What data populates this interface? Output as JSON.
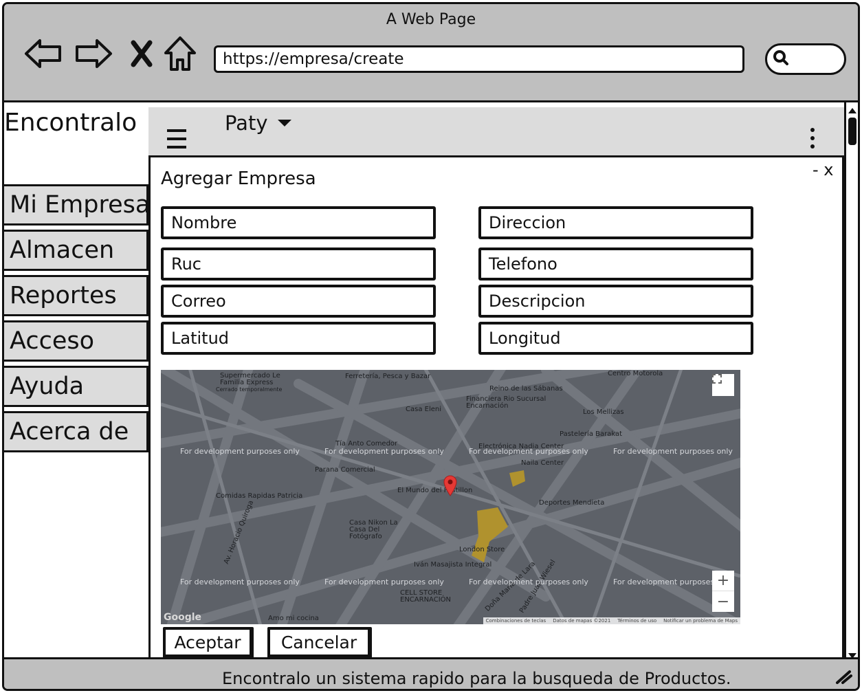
{
  "window": {
    "title": "A Web Page"
  },
  "browser": {
    "url": "https://empresa/create",
    "icons": [
      "back-icon",
      "forward-icon",
      "stop-icon",
      "home-icon",
      "search-icon"
    ]
  },
  "sidebar": {
    "brand": "Encontralo",
    "items": [
      {
        "label": "Mi Empresa"
      },
      {
        "label": "Almacen"
      },
      {
        "label": "Reportes"
      },
      {
        "label": "Acceso"
      },
      {
        "label": "Ayuda"
      },
      {
        "label": "Acerca de"
      }
    ]
  },
  "header": {
    "user": "Paty"
  },
  "dialog": {
    "title": "Agregar Empresa",
    "close": "- x",
    "fields": {
      "nombre": "Nombre",
      "direccion": "Direccion",
      "ruc": "Ruc",
      "telefono": "Telefono",
      "correo": "Correo",
      "descripcion": "Descripcion",
      "latitud": "Latitud",
      "longitud": "Longitud"
    },
    "map": {
      "watermark": "For development purposes only",
      "zoom_in": "+",
      "zoom_out": "−",
      "google": "Google",
      "footer": [
        "Combinaciones de teclas",
        "Datos de mapas ©2021",
        "Términos de uso",
        "Notificar un problema de Maps"
      ],
      "places": [
        "Supermercado Le Familia Express",
        "Cerrado temporalmente",
        "Ferretería, Pesca y Bazar",
        "Reino de las Sábanas",
        "Centro Motorola",
        "Financiera Rio Sucursal Encarnación",
        "Casa Eleni",
        "Los Mellizas",
        "Pastelería Barakat",
        "Electrónica Nadia Center",
        "Naila Center",
        "Tía Anto Comedor",
        "Parana Comercial",
        "Comidas Rapidas Patricia",
        "El Mundo del Pastillon",
        "Deportes Mendieta",
        "Casa Nikon La Casa Del Fotógrafo",
        "London Store",
        "Iván Masajista Integral",
        "CELL STORE ENCARNACIÓN",
        "Amo mi cocina",
        "Av. Horacio Quiroga",
        "Doña María de Lara",
        "Padre Juan Wiesel"
      ]
    },
    "buttons": {
      "accept": "Aceptar",
      "cancel": "Cancelar"
    }
  },
  "statusbar": {
    "text": "Encontralo un sistema rapido para la busqueda de Productos."
  }
}
